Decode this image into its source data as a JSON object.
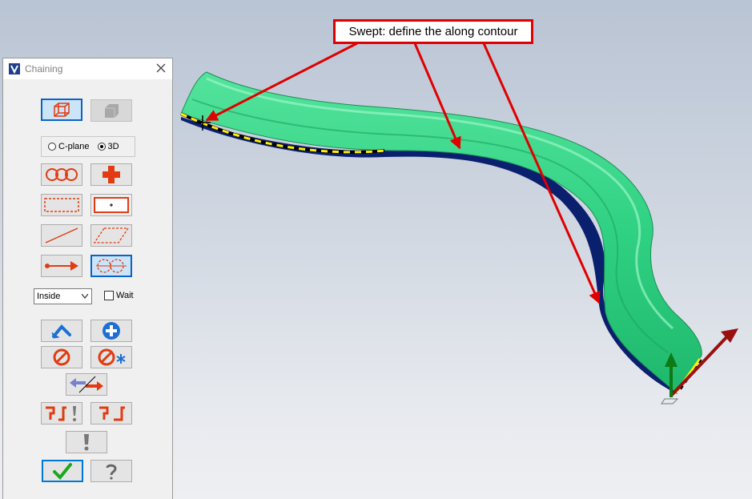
{
  "callout": {
    "text": "Swept: define the along contour"
  },
  "dialog": {
    "title": "Chaining",
    "mode_options": [
      {
        "label": "C-plane",
        "selected": false
      },
      {
        "label": "3D",
        "selected": true
      }
    ],
    "select_value": "Inside",
    "wait_label": "Wait",
    "wait_checked": false
  },
  "icons": [
    "wireframe-cube-icon",
    "solid-cube-icon",
    "chain-links-icon",
    "red-plus-icon",
    "window-select-icon",
    "area-select-icon",
    "single-line-icon",
    "polygon-select-icon",
    "vector-arrow-icon",
    "partial-chain-icon",
    "undo-arrow-icon",
    "add-plus-icon",
    "unselect-icon",
    "unselect-all-icon",
    "reverse-direction-icon",
    "end-options-icon",
    "end-toggle-icon",
    "options-icon",
    "ok-check-icon",
    "help-icon"
  ],
  "colors": {
    "callout_border": "#e00000",
    "surface": "#2fd182",
    "dialog_bg": "#f0f0f0"
  }
}
